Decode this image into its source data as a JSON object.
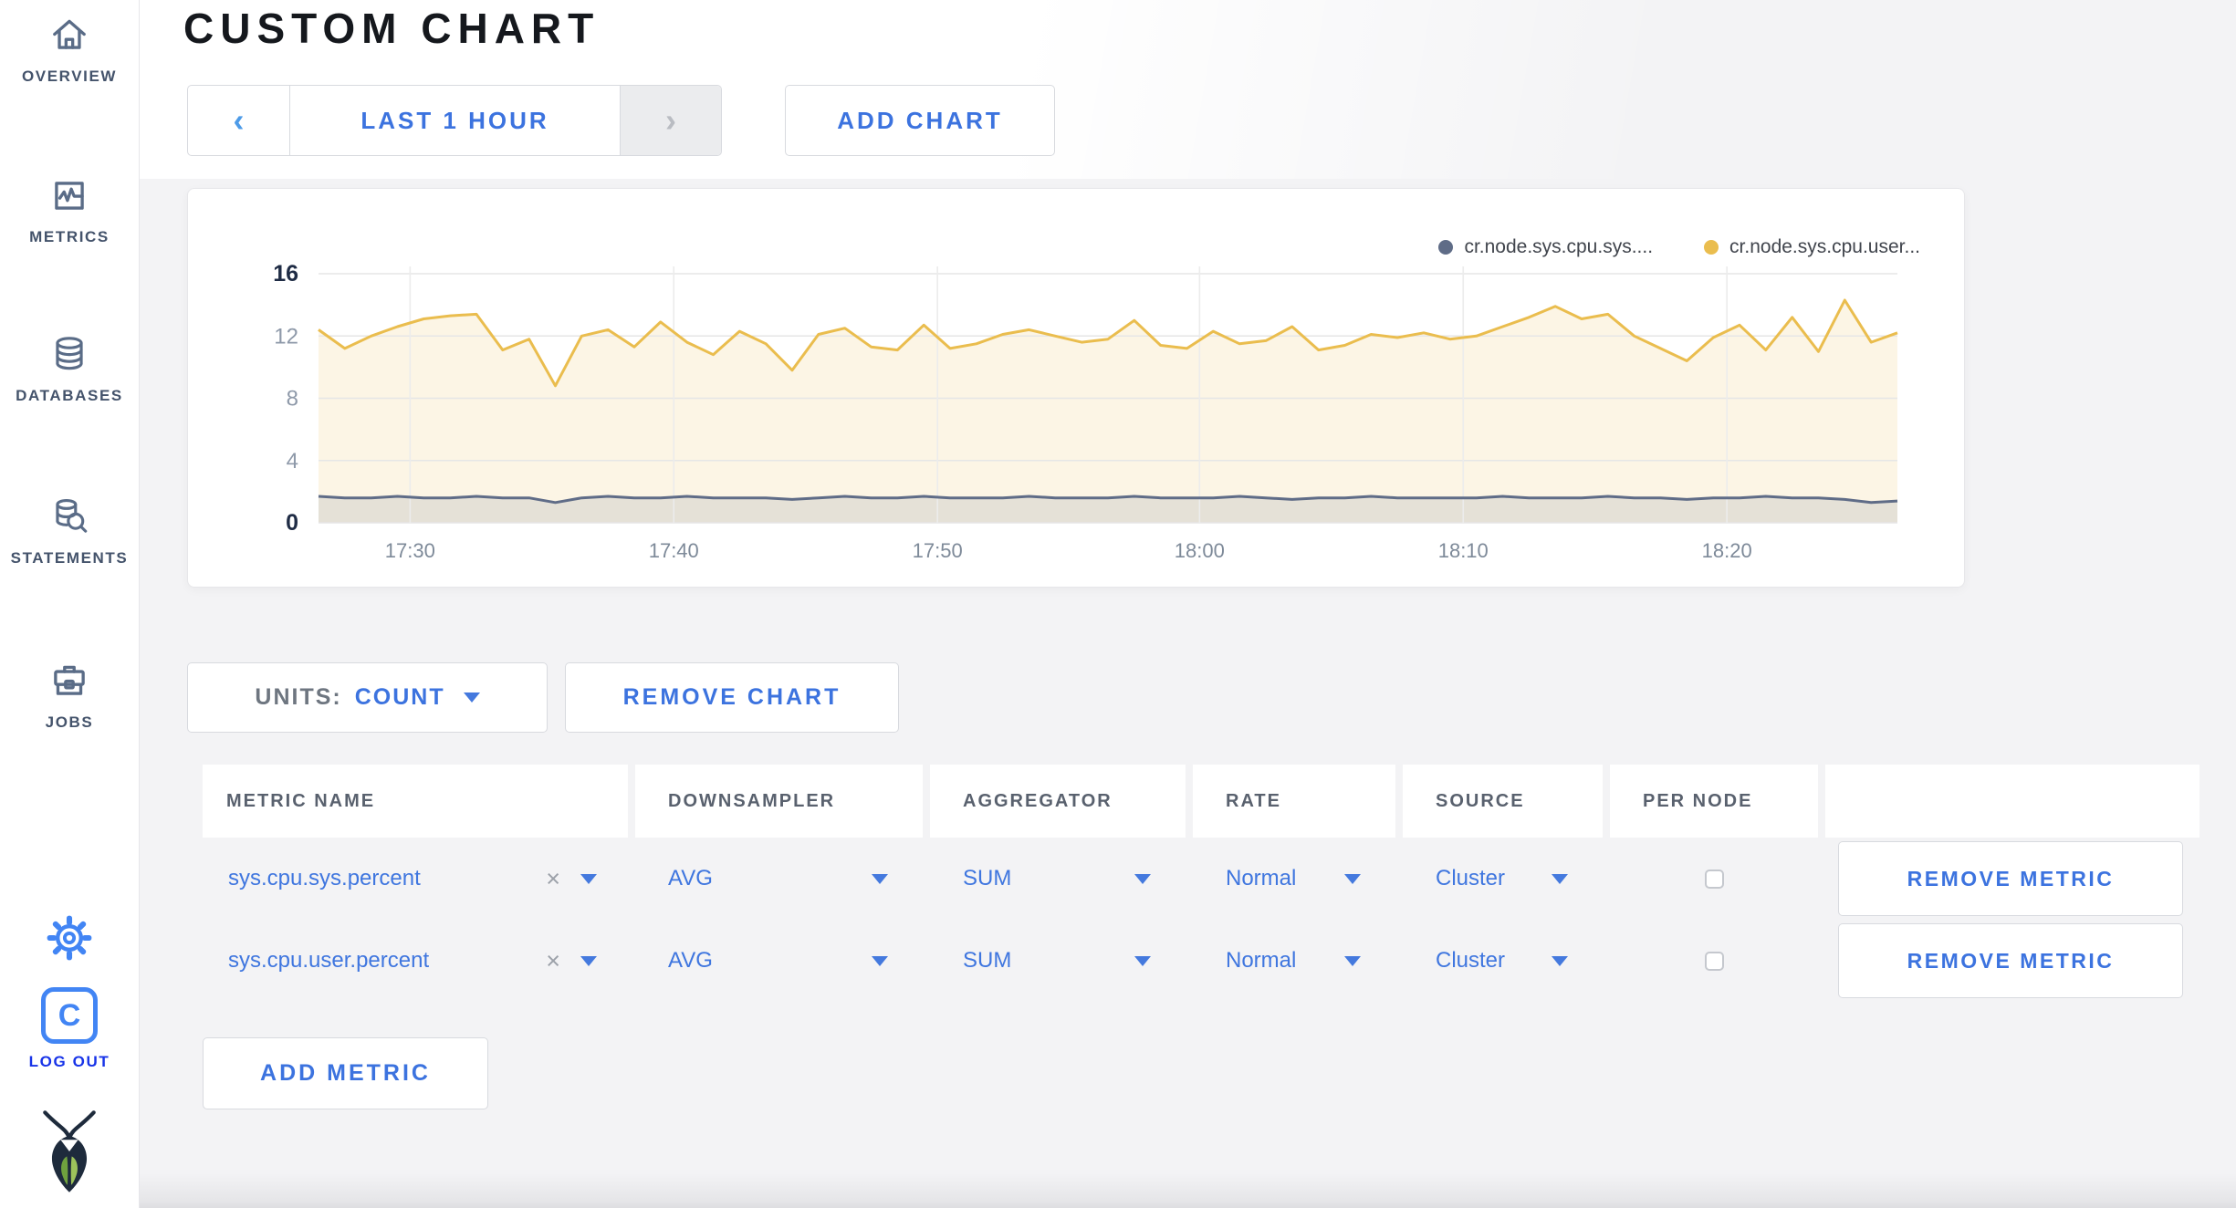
{
  "sidebar": {
    "items": [
      {
        "label": "OVERVIEW",
        "icon": "home-icon"
      },
      {
        "label": "METRICS",
        "icon": "metrics-icon"
      },
      {
        "label": "DATABASES",
        "icon": "database-icon"
      },
      {
        "label": "STATEMENTS",
        "icon": "statements-icon"
      },
      {
        "label": "JOBS",
        "icon": "jobs-icon"
      }
    ],
    "logout_label": "LOG OUT",
    "logout_letter": "C"
  },
  "header": {
    "title": "CUSTOM CHART"
  },
  "toolbar": {
    "prev_arrow": "‹",
    "time_range": "LAST 1 HOUR",
    "next_arrow": "›",
    "add_chart": "ADD CHART"
  },
  "chart_data": {
    "type": "area",
    "title": "",
    "xlabel": "",
    "ylabel": "",
    "ylim": [
      0,
      16
    ],
    "y_ticks": [
      0,
      4,
      8,
      12,
      16
    ],
    "grid": true,
    "legend_position": "top-right",
    "x_ticks": [
      {
        "label": "17:30",
        "frac": 0.058
      },
      {
        "label": "17:40",
        "frac": 0.225
      },
      {
        "label": "17:50",
        "frac": 0.392
      },
      {
        "label": "18:00",
        "frac": 0.558
      },
      {
        "label": "18:10",
        "frac": 0.725
      },
      {
        "label": "18:20",
        "frac": 0.892
      }
    ],
    "series": [
      {
        "name": "cr.node.sys.cpu.sys....",
        "color": "#5F6C87",
        "fill": "rgba(95,108,135,0.14)",
        "values": [
          1.7,
          1.6,
          1.6,
          1.7,
          1.6,
          1.6,
          1.7,
          1.6,
          1.6,
          1.3,
          1.6,
          1.7,
          1.6,
          1.6,
          1.7,
          1.6,
          1.6,
          1.6,
          1.5,
          1.6,
          1.7,
          1.6,
          1.6,
          1.7,
          1.6,
          1.6,
          1.6,
          1.7,
          1.6,
          1.6,
          1.6,
          1.7,
          1.6,
          1.6,
          1.6,
          1.7,
          1.6,
          1.5,
          1.6,
          1.6,
          1.7,
          1.6,
          1.6,
          1.6,
          1.6,
          1.7,
          1.6,
          1.6,
          1.6,
          1.7,
          1.6,
          1.6,
          1.5,
          1.6,
          1.6,
          1.7,
          1.6,
          1.6,
          1.5,
          1.3,
          1.4
        ]
      },
      {
        "name": "cr.node.sys.cpu.user...",
        "color": "#EABD4E",
        "fill": "rgba(234,189,78,0.15)",
        "values": [
          12.4,
          11.2,
          12.0,
          12.6,
          13.1,
          13.3,
          13.4,
          11.1,
          11.8,
          8.8,
          12.0,
          12.4,
          11.3,
          12.9,
          11.6,
          10.8,
          12.3,
          11.5,
          9.8,
          12.1,
          12.5,
          11.3,
          11.1,
          12.7,
          11.2,
          11.5,
          12.1,
          12.4,
          12.0,
          11.6,
          11.8,
          13.0,
          11.4,
          11.2,
          12.3,
          11.5,
          11.7,
          12.6,
          11.1,
          11.4,
          12.1,
          11.9,
          12.2,
          11.8,
          12.0,
          12.6,
          13.2,
          13.9,
          13.1,
          13.4,
          12.0,
          11.2,
          10.4,
          11.9,
          12.7,
          11.1,
          13.2,
          11.0,
          14.3,
          11.6,
          12.2
        ]
      }
    ]
  },
  "units_row": {
    "units_label": "UNITS:",
    "units_value": "COUNT",
    "remove_chart": "REMOVE CHART"
  },
  "table": {
    "headers": [
      "METRIC NAME",
      "DOWNSAMPLER",
      "AGGREGATOR",
      "RATE",
      "SOURCE",
      "PER NODE"
    ],
    "rows": [
      {
        "name": "sys.cpu.sys.percent",
        "clear": "×",
        "downsampler": "AVG",
        "aggregator": "SUM",
        "rate": "Normal",
        "source": "Cluster",
        "per_node": false,
        "remove": "REMOVE METRIC"
      },
      {
        "name": "sys.cpu.user.percent",
        "clear": "×",
        "downsampler": "AVG",
        "aggregator": "SUM",
        "rate": "Normal",
        "source": "Cluster",
        "per_node": false,
        "remove": "REMOVE METRIC"
      }
    ],
    "add_metric": "ADD METRIC"
  },
  "colors": {
    "primary_blue": "#3C73DF",
    "icon_blue": "#4285F4",
    "logout_blue": "#1733E8",
    "sidebar_slate": "#5A6C87",
    "series_sys": "#5F6C87",
    "series_user": "#EABD4E",
    "page_bg": "#F3F3F5"
  }
}
